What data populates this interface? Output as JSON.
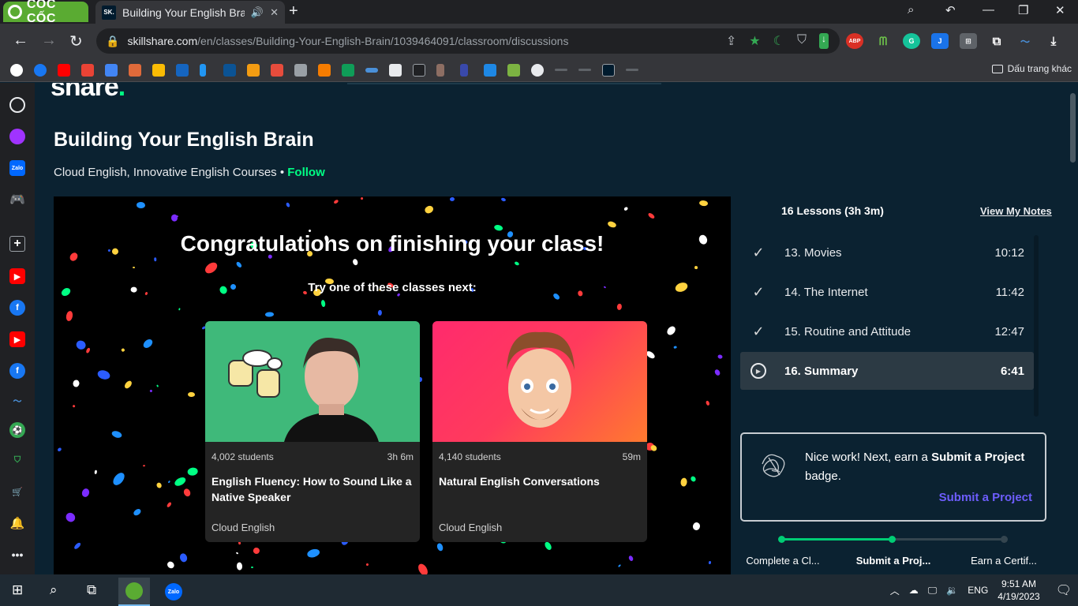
{
  "browser": {
    "brand": "CỐC CỐC",
    "tab": {
      "favicon": "SK.",
      "title": "Building Your English Brai"
    },
    "url": {
      "host": "skillshare.com",
      "path": "/en/classes/Building-Your-English-Brain/1039464091/classroom/discussions"
    },
    "bookmarks_other": "Dấu trang khác"
  },
  "page": {
    "logo": "share",
    "title": "Building Your English Brain",
    "teacher": "Cloud English, Innovative English Courses",
    "separator": "•",
    "follow": "Follow",
    "video": {
      "congrats": "Congratulations on finishing your class!",
      "try_next": "Try one of these classes next:",
      "cards": [
        {
          "students": "4,002 students",
          "duration": "3h 6m",
          "title": "English Fluency: How to Sound Like a Native Speaker",
          "teacher": "Cloud English",
          "thumb_color": "#3fb97a"
        },
        {
          "students": "4,140 students",
          "duration": "59m",
          "title": "Natural English Conversations",
          "teacher": "Cloud English",
          "thumb_color": "#ff3b5c"
        }
      ]
    },
    "lessons": {
      "header": "16 Lessons (3h 3m)",
      "view_notes": "View My Notes",
      "items": [
        {
          "label": "13. Movies",
          "duration": "10:12",
          "state": "done"
        },
        {
          "label": "14. The Internet",
          "duration": "11:42",
          "state": "done"
        },
        {
          "label": "15. Routine and Attitude",
          "duration": "12:47",
          "state": "done"
        },
        {
          "label": "16. Summary",
          "duration": "6:41",
          "state": "playing"
        }
      ]
    },
    "project": {
      "text_a": "Nice work! Next, earn a ",
      "text_b": "Submit a Project",
      "text_c": " badge.",
      "cta": "Submit a Project"
    },
    "steps": [
      "Complete a Cl...",
      "Submit a Proj...",
      "Earn a Certif..."
    ]
  },
  "taskbar": {
    "lang": "ENG",
    "time": "9:51 AM",
    "date": "4/19/2023"
  },
  "colors": {
    "accent_green": "#00ff84",
    "brand_purple": "#6d5dfc",
    "page_bg": "#0b2231"
  }
}
